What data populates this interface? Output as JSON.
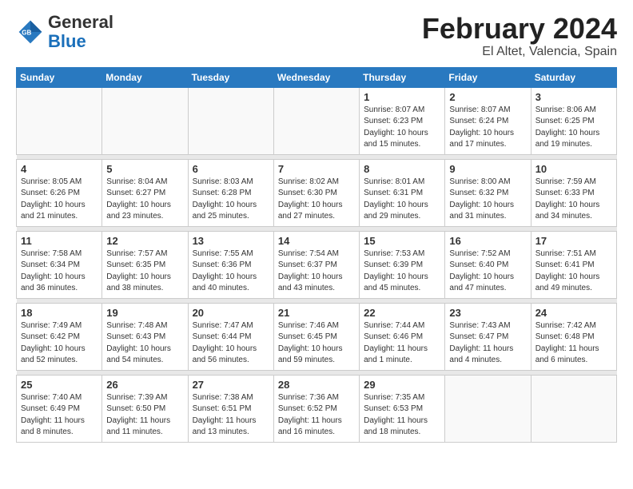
{
  "header": {
    "logo_line1": "General",
    "logo_line2": "Blue",
    "title": "February 2024",
    "subtitle": "El Altet, Valencia, Spain"
  },
  "weekdays": [
    "Sunday",
    "Monday",
    "Tuesday",
    "Wednesday",
    "Thursday",
    "Friday",
    "Saturday"
  ],
  "weeks": [
    [
      {
        "day": "",
        "sunrise": "",
        "sunset": "",
        "daylight": "",
        "empty": true
      },
      {
        "day": "",
        "sunrise": "",
        "sunset": "",
        "daylight": "",
        "empty": true
      },
      {
        "day": "",
        "sunrise": "",
        "sunset": "",
        "daylight": "",
        "empty": true
      },
      {
        "day": "",
        "sunrise": "",
        "sunset": "",
        "daylight": "",
        "empty": true
      },
      {
        "day": "1",
        "sunrise": "Sunrise: 8:07 AM",
        "sunset": "Sunset: 6:23 PM",
        "daylight": "Daylight: 10 hours and 15 minutes.",
        "empty": false
      },
      {
        "day": "2",
        "sunrise": "Sunrise: 8:07 AM",
        "sunset": "Sunset: 6:24 PM",
        "daylight": "Daylight: 10 hours and 17 minutes.",
        "empty": false
      },
      {
        "day": "3",
        "sunrise": "Sunrise: 8:06 AM",
        "sunset": "Sunset: 6:25 PM",
        "daylight": "Daylight: 10 hours and 19 minutes.",
        "empty": false
      }
    ],
    [
      {
        "day": "4",
        "sunrise": "Sunrise: 8:05 AM",
        "sunset": "Sunset: 6:26 PM",
        "daylight": "Daylight: 10 hours and 21 minutes.",
        "empty": false
      },
      {
        "day": "5",
        "sunrise": "Sunrise: 8:04 AM",
        "sunset": "Sunset: 6:27 PM",
        "daylight": "Daylight: 10 hours and 23 minutes.",
        "empty": false
      },
      {
        "day": "6",
        "sunrise": "Sunrise: 8:03 AM",
        "sunset": "Sunset: 6:28 PM",
        "daylight": "Daylight: 10 hours and 25 minutes.",
        "empty": false
      },
      {
        "day": "7",
        "sunrise": "Sunrise: 8:02 AM",
        "sunset": "Sunset: 6:30 PM",
        "daylight": "Daylight: 10 hours and 27 minutes.",
        "empty": false
      },
      {
        "day": "8",
        "sunrise": "Sunrise: 8:01 AM",
        "sunset": "Sunset: 6:31 PM",
        "daylight": "Daylight: 10 hours and 29 minutes.",
        "empty": false
      },
      {
        "day": "9",
        "sunrise": "Sunrise: 8:00 AM",
        "sunset": "Sunset: 6:32 PM",
        "daylight": "Daylight: 10 hours and 31 minutes.",
        "empty": false
      },
      {
        "day": "10",
        "sunrise": "Sunrise: 7:59 AM",
        "sunset": "Sunset: 6:33 PM",
        "daylight": "Daylight: 10 hours and 34 minutes.",
        "empty": false
      }
    ],
    [
      {
        "day": "11",
        "sunrise": "Sunrise: 7:58 AM",
        "sunset": "Sunset: 6:34 PM",
        "daylight": "Daylight: 10 hours and 36 minutes.",
        "empty": false
      },
      {
        "day": "12",
        "sunrise": "Sunrise: 7:57 AM",
        "sunset": "Sunset: 6:35 PM",
        "daylight": "Daylight: 10 hours and 38 minutes.",
        "empty": false
      },
      {
        "day": "13",
        "sunrise": "Sunrise: 7:55 AM",
        "sunset": "Sunset: 6:36 PM",
        "daylight": "Daylight: 10 hours and 40 minutes.",
        "empty": false
      },
      {
        "day": "14",
        "sunrise": "Sunrise: 7:54 AM",
        "sunset": "Sunset: 6:37 PM",
        "daylight": "Daylight: 10 hours and 43 minutes.",
        "empty": false
      },
      {
        "day": "15",
        "sunrise": "Sunrise: 7:53 AM",
        "sunset": "Sunset: 6:39 PM",
        "daylight": "Daylight: 10 hours and 45 minutes.",
        "empty": false
      },
      {
        "day": "16",
        "sunrise": "Sunrise: 7:52 AM",
        "sunset": "Sunset: 6:40 PM",
        "daylight": "Daylight: 10 hours and 47 minutes.",
        "empty": false
      },
      {
        "day": "17",
        "sunrise": "Sunrise: 7:51 AM",
        "sunset": "Sunset: 6:41 PM",
        "daylight": "Daylight: 10 hours and 49 minutes.",
        "empty": false
      }
    ],
    [
      {
        "day": "18",
        "sunrise": "Sunrise: 7:49 AM",
        "sunset": "Sunset: 6:42 PM",
        "daylight": "Daylight: 10 hours and 52 minutes.",
        "empty": false
      },
      {
        "day": "19",
        "sunrise": "Sunrise: 7:48 AM",
        "sunset": "Sunset: 6:43 PM",
        "daylight": "Daylight: 10 hours and 54 minutes.",
        "empty": false
      },
      {
        "day": "20",
        "sunrise": "Sunrise: 7:47 AM",
        "sunset": "Sunset: 6:44 PM",
        "daylight": "Daylight: 10 hours and 56 minutes.",
        "empty": false
      },
      {
        "day": "21",
        "sunrise": "Sunrise: 7:46 AM",
        "sunset": "Sunset: 6:45 PM",
        "daylight": "Daylight: 10 hours and 59 minutes.",
        "empty": false
      },
      {
        "day": "22",
        "sunrise": "Sunrise: 7:44 AM",
        "sunset": "Sunset: 6:46 PM",
        "daylight": "Daylight: 11 hours and 1 minute.",
        "empty": false
      },
      {
        "day": "23",
        "sunrise": "Sunrise: 7:43 AM",
        "sunset": "Sunset: 6:47 PM",
        "daylight": "Daylight: 11 hours and 4 minutes.",
        "empty": false
      },
      {
        "day": "24",
        "sunrise": "Sunrise: 7:42 AM",
        "sunset": "Sunset: 6:48 PM",
        "daylight": "Daylight: 11 hours and 6 minutes.",
        "empty": false
      }
    ],
    [
      {
        "day": "25",
        "sunrise": "Sunrise: 7:40 AM",
        "sunset": "Sunset: 6:49 PM",
        "daylight": "Daylight: 11 hours and 8 minutes.",
        "empty": false
      },
      {
        "day": "26",
        "sunrise": "Sunrise: 7:39 AM",
        "sunset": "Sunset: 6:50 PM",
        "daylight": "Daylight: 11 hours and 11 minutes.",
        "empty": false
      },
      {
        "day": "27",
        "sunrise": "Sunrise: 7:38 AM",
        "sunset": "Sunset: 6:51 PM",
        "daylight": "Daylight: 11 hours and 13 minutes.",
        "empty": false
      },
      {
        "day": "28",
        "sunrise": "Sunrise: 7:36 AM",
        "sunset": "Sunset: 6:52 PM",
        "daylight": "Daylight: 11 hours and 16 minutes.",
        "empty": false
      },
      {
        "day": "29",
        "sunrise": "Sunrise: 7:35 AM",
        "sunset": "Sunset: 6:53 PM",
        "daylight": "Daylight: 11 hours and 18 minutes.",
        "empty": false
      },
      {
        "day": "",
        "sunrise": "",
        "sunset": "",
        "daylight": "",
        "empty": true
      },
      {
        "day": "",
        "sunrise": "",
        "sunset": "",
        "daylight": "",
        "empty": true
      }
    ]
  ]
}
